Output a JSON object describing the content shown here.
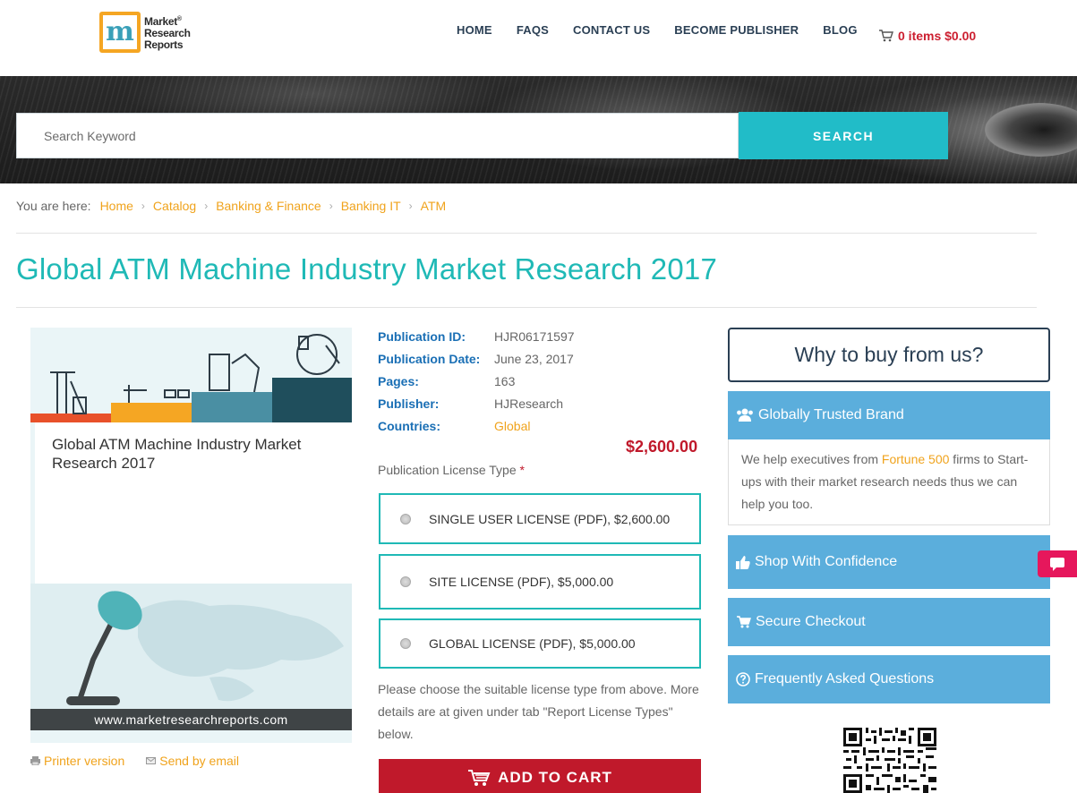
{
  "header": {
    "logo": {
      "line1": "Market",
      "line2": "Research",
      "line3": "Reports",
      "mark": "m",
      "trademark": "®"
    },
    "nav": [
      "HOME",
      "FAQS",
      "CONTACT US",
      "BECOME PUBLISHER",
      "BLOG"
    ],
    "cart": {
      "label": "0 items $0.00",
      "icon": "cart-icon"
    }
  },
  "search": {
    "placeholder": "Search Keyword",
    "button": "SEARCH"
  },
  "breadcrumb": {
    "lead": "You are here:",
    "items": [
      "Home",
      "Catalog",
      "Banking & Finance",
      "Banking IT",
      "ATM"
    ]
  },
  "page_title": "Global ATM Machine Industry Market Research 2017",
  "cover": {
    "title": "Global ATM Machine Industry Market Research 2017",
    "footer": "www.marketresearchreports.com"
  },
  "actions": {
    "print": "Printer version",
    "email": "Send by email"
  },
  "details": {
    "rows": [
      {
        "key": "Publication ID:",
        "value": "HJR06171597"
      },
      {
        "key": "Publication Date:",
        "value": "June 23, 2017"
      },
      {
        "key": "Pages:",
        "value": "163"
      },
      {
        "key": "Publisher:",
        "value": "HJResearch"
      },
      {
        "key": "Countries:",
        "value": "Global"
      }
    ],
    "price": "$2,600.00",
    "license_label": "Publication License Type",
    "required_mark": "*",
    "licenses": [
      "SINGLE USER LICENSE (PDF), $2,600.00",
      "SITE LICENSE (PDF), $5,000.00",
      "GLOBAL LICENSE (PDF), $5,000.00"
    ],
    "note": "Please choose the suitable license type from above. More details are at given under tab \"Report License Types\" below.",
    "add_to_cart": "ADD TO CART"
  },
  "sidebar": {
    "why": "Why to buy from us?",
    "trusted": "Globally Trusted Brand",
    "trusted_body_pre": "We help executives from ",
    "trusted_body_hl": "Fortune 500",
    "trusted_body_post": " firms to Start-ups with their market research needs thus we can help you too.",
    "shop": "Shop With Confidence",
    "checkout": "Secure Checkout",
    "faq": "Frequently Asked Questions"
  },
  "colors": {
    "accent": "#1fb9b6",
    "link": "#f0a31c",
    "price": "#c0192b",
    "panel": "#5baedc",
    "nav": "#2a3f54"
  }
}
